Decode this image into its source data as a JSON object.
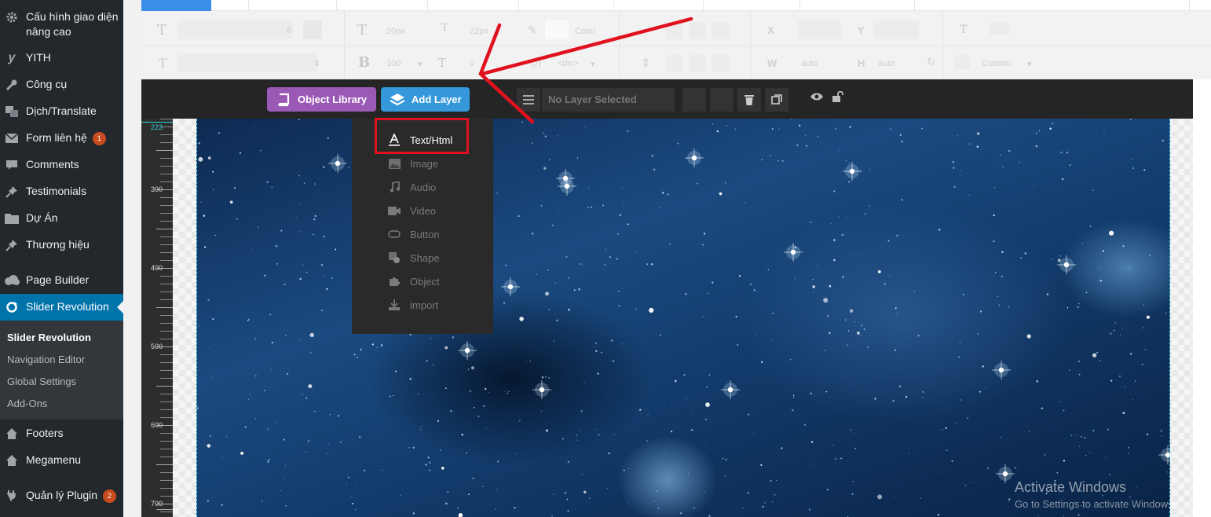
{
  "sidebar": {
    "items": [
      {
        "label": "Cấu hình giao diện nâng cao",
        "line2": "",
        "icon": "gear-icon"
      },
      {
        "label": "YITH",
        "icon": "yith-icon"
      },
      {
        "label": "Công cụ",
        "icon": "wrench-icon"
      },
      {
        "label": "Dịch/Translate",
        "icon": "translate-icon"
      },
      {
        "label": "Form liên hệ",
        "icon": "envelope-icon",
        "badge": "1"
      },
      {
        "label": "Comments",
        "icon": "comment-icon"
      },
      {
        "label": "Testimonials",
        "icon": "pin-icon"
      },
      {
        "label": "Dự Án",
        "icon": "folder-icon"
      },
      {
        "label": "Thương hiệu",
        "icon": "pin-icon"
      },
      {
        "label": "Page Builder",
        "icon": "cloud-icon"
      },
      {
        "label": "Slider Revolution",
        "icon": "refresh-icon",
        "active": true
      },
      {
        "label": "Footers",
        "icon": "home-icon"
      },
      {
        "label": "Megamenu",
        "icon": "home-icon"
      },
      {
        "label": "Quản lý Plugin",
        "icon": "plug-icon",
        "badge": "2"
      }
    ],
    "submenu": [
      "Slider Revolution",
      "Navigation Editor",
      "Global Settings",
      "Add-Ons"
    ]
  },
  "toolbar": {
    "font_size": "20px",
    "line_height": "22px",
    "color_label": "Color",
    "font_weight": "100",
    "tag": "<div>",
    "width_label": "W",
    "height_label": "H",
    "x_label": "X",
    "y_label": "Y",
    "width_value": "auto",
    "height_value": "auto",
    "custom_label": "Custom",
    "d_value": "0"
  },
  "layerbar": {
    "object_library": "Object Library",
    "add_layer": "Add Layer",
    "no_layer": "No Layer Selected"
  },
  "ruler": {
    "marker": "223",
    "ticks": [
      "300",
      "400",
      "500",
      "600",
      "700"
    ]
  },
  "dropdown": {
    "items": [
      {
        "label": "Text/Html",
        "icon": "text-icon"
      },
      {
        "label": "Image",
        "icon": "image-icon"
      },
      {
        "label": "Audio",
        "icon": "music-icon"
      },
      {
        "label": "Video",
        "icon": "video-icon"
      },
      {
        "label": "Button",
        "icon": "button-icon"
      },
      {
        "label": "Shape",
        "icon": "shape-icon"
      },
      {
        "label": "Object",
        "icon": "puzzle-icon"
      },
      {
        "label": "import",
        "icon": "import-icon"
      }
    ]
  },
  "watermark": {
    "title": "Activate Windows",
    "sub": "Go to Settings to activate Windows."
  },
  "colors": {
    "sidebar": "#23282d",
    "active": "#0073aa",
    "object_library": "#9b59b6",
    "add_layer": "#3498db",
    "annotation": "#e0121f"
  }
}
